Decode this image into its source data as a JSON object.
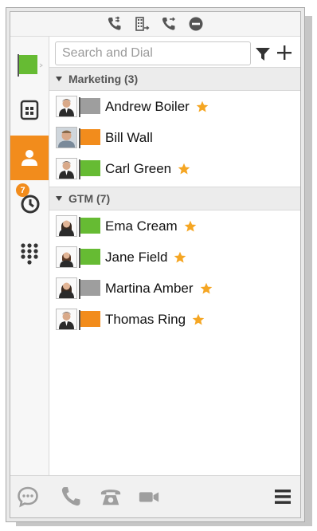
{
  "colors": {
    "accent": "#f28c1c",
    "presence_available": "#66bb33",
    "presence_busy": "#f28c1c",
    "presence_offline": "#9e9e9e",
    "star": "#f5a623"
  },
  "topbar": {
    "icons": [
      "call-forward-icon",
      "building-transfer-icon",
      "call-transfer-icon",
      "do-not-disturb-icon"
    ]
  },
  "sidebar": {
    "items": [
      {
        "icon": "presence-flag-icon"
      },
      {
        "icon": "company-directory-icon"
      },
      {
        "icon": "contacts-icon",
        "active": true
      },
      {
        "icon": "history-clock-icon",
        "badge": "7"
      },
      {
        "icon": "dialpad-icon"
      }
    ]
  },
  "search": {
    "placeholder": "Search and Dial",
    "value": ""
  },
  "groups": [
    {
      "name": "Marketing (3)",
      "contacts": [
        {
          "name": "Andrew Boiler",
          "presence": "offline",
          "favorite": true
        },
        {
          "name": "Bill Wall",
          "presence": "busy",
          "favorite": false
        },
        {
          "name": "Carl Green",
          "presence": "available",
          "favorite": true
        }
      ]
    },
    {
      "name": "GTM (7)",
      "contacts": [
        {
          "name": "Ema Cream",
          "presence": "available",
          "favorite": true
        },
        {
          "name": "Jane Field",
          "presence": "available",
          "favorite": true
        },
        {
          "name": "Martina Amber",
          "presence": "offline",
          "favorite": true
        },
        {
          "name": "Thomas Ring",
          "presence": "busy",
          "favorite": true
        }
      ]
    }
  ],
  "bottombar": {
    "icons": [
      "chat-icon",
      "phone-icon",
      "desk-phone-icon",
      "video-icon",
      "menu-icon"
    ]
  }
}
